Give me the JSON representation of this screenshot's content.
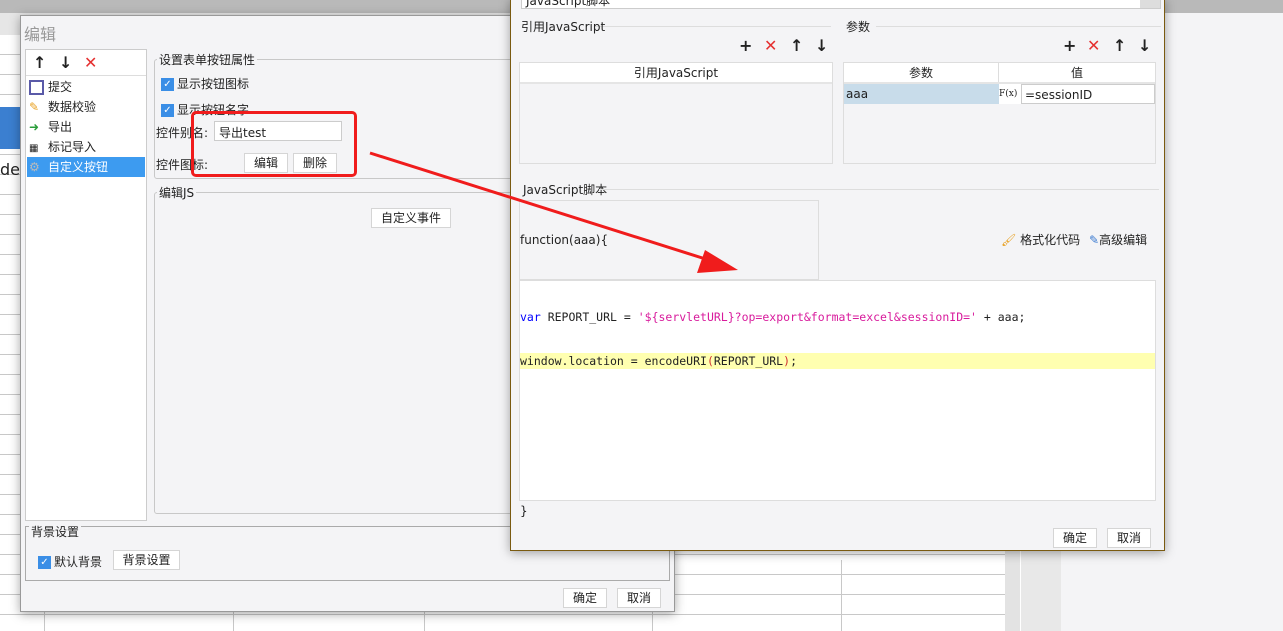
{
  "background": {
    "partial_text": "de)"
  },
  "left_dialog": {
    "title": "编辑",
    "toolbar": {
      "up": "↑",
      "down": "↓",
      "delete": "✕"
    },
    "items": [
      {
        "label": "提交",
        "icon": "save-icon"
      },
      {
        "label": "数据校验",
        "icon": "pencil-icon"
      },
      {
        "label": "导出",
        "icon": "export-icon"
      },
      {
        "label": "标记导入",
        "icon": "excel-import-icon"
      },
      {
        "label": "自定义按钮",
        "icon": "gear-icon",
        "selected": true
      }
    ],
    "props": {
      "legend": "设置表单按钮属性",
      "show_icon": "显示按钮图标",
      "show_name": "显示按钮名字",
      "alias_label": "控件别名:",
      "alias_value": "导出test",
      "icon_label": "控件图标:",
      "edit_btn": "编辑",
      "delete_btn": "删除"
    },
    "js": {
      "legend": "编辑JS",
      "custom_event": "自定义事件"
    },
    "bg": {
      "legend": "背景设置",
      "default_bg": "默认背景",
      "bg_settings": "背景设置"
    },
    "ok": "确定",
    "cancel": "取消"
  },
  "right_dialog": {
    "top_select": "JavaScript脚本",
    "ref_js": {
      "legend": "引用JavaScript",
      "col": "引用JavaScript"
    },
    "params": {
      "legend": "参数",
      "col_param": "参数",
      "col_value": "值",
      "rows": [
        {
          "param": "aaa",
          "fx": "F(x)",
          "value": "=sessionID"
        }
      ]
    },
    "script": {
      "legend": "JavaScript脚本",
      "signature": "function(aaa){",
      "format": "格式化代码",
      "advanced": "高级编辑",
      "line1": {
        "kw": "var",
        "a": " REPORT_URL = ",
        "str": "'${servletURL}?op=export&format=excel&sessionID='",
        "b": " + aaa;"
      },
      "line2": {
        "a": "window.location = encodeURI",
        "p1": "(",
        "b": "REPORT_URL",
        "p2": ")",
        ";": ";"
      },
      "closing": "}"
    },
    "ok": "确定",
    "cancel": "取消"
  },
  "colors": {
    "accent": "#3a8ee6",
    "highlight": "#ff0000",
    "code_kw": "#0000ff",
    "code_str": "#d81b9c",
    "line_highlight": "#ffffb0"
  }
}
